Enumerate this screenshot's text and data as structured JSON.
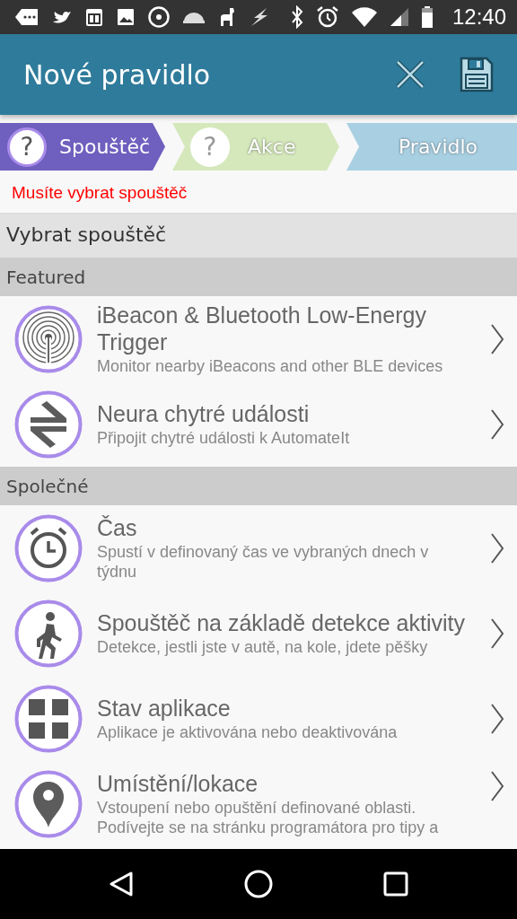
{
  "status_bar": {
    "time": "12:40"
  },
  "toolbar": {
    "title": "Nové pravidlo"
  },
  "steps": [
    {
      "label": "Spouštěč",
      "kind": "question",
      "icon_text": "?",
      "selected": true,
      "color": "#6f5fbe"
    },
    {
      "label": "Akce",
      "kind": "question",
      "icon_text": "?",
      "selected": false,
      "color": "#d5e8bc"
    },
    {
      "label": "Pravidlo",
      "kind": "plain",
      "selected": false,
      "color": "#a9d0e2"
    }
  ],
  "error": "Musíte vybrat spouštěč",
  "list_title": "Vybrat spouštěč",
  "sections": [
    {
      "title": "Featured",
      "items": [
        {
          "title": "iBeacon & Bluetooth Low-Energy Trigger",
          "description": "Monitor nearby iBeacons and other BLE devices",
          "kind": "beacon"
        },
        {
          "title": "Neura chytré události",
          "description": "Připojit chytré události k AutomateIt",
          "kind": "exchange"
        }
      ]
    },
    {
      "title": "Společné",
      "items": [
        {
          "title": "Čas",
          "description": "Spustí v definovaný čas ve vybraných dnech v týdnu",
          "kind": "clock"
        },
        {
          "title": "Spouštěč na základě detekce aktivity",
          "description": "Detekce, jestli jste v autě, na kole, jdete pěšky",
          "kind": "walk"
        },
        {
          "title": "Stav aplikace",
          "description": "Aplikace je aktivována nebo deaktivována",
          "kind": "grid"
        },
        {
          "title": "Umístění/lokace",
          "description": "Vstoupení nebo opuštění definované oblasti. Podívejte se na stránku programátora pro tipy a",
          "kind": "pin"
        }
      ]
    }
  ]
}
